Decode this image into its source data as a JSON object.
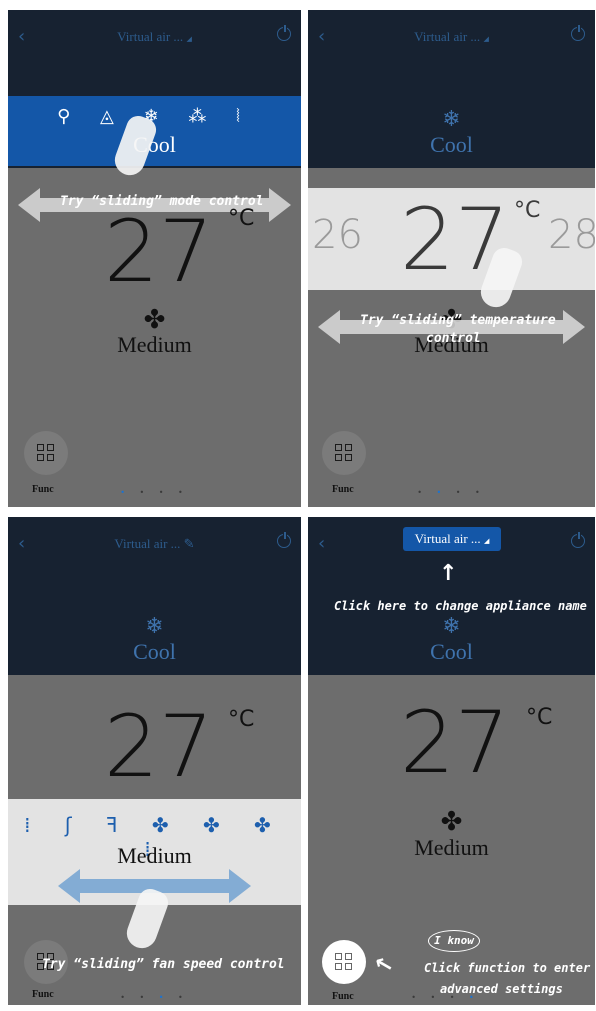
{
  "header": {
    "back_glyph": "‹",
    "title": "Virtual air ...",
    "title_suffix": "◢",
    "edit_suffix": "✎"
  },
  "mode": {
    "label": "Cool",
    "icon": "snowflake-icon"
  },
  "mode_bar": {
    "icons": "⚲ ◬ ❄ ⁂ ⦚",
    "label": "Cool"
  },
  "temperature": {
    "value": "27",
    "unit": "°C",
    "prev": "26",
    "next": "28"
  },
  "fan": {
    "label": "Medium",
    "icon": "fan-icon",
    "speeds": "⁞ ʃ ꟻ ✤ ✤ ✤ ⁞"
  },
  "func": {
    "label": "Func"
  },
  "pager": {
    "dots": "• • • •"
  },
  "hints": {
    "mode": "Try “sliding” mode control",
    "temp_line1": "Try “sliding” temperature",
    "temp_line2": "control",
    "fan": "Try “sliding” fan speed control",
    "name": "Click here to change appliance name",
    "i_know": "I know",
    "func_line1": "Click function to enter",
    "func_line2": "advanced settings"
  },
  "colors": {
    "header_bg": "#172231",
    "body_bg": "#6d6d6d",
    "accent_blue": "#1457a8",
    "icon_blue": "#3f73ad"
  }
}
